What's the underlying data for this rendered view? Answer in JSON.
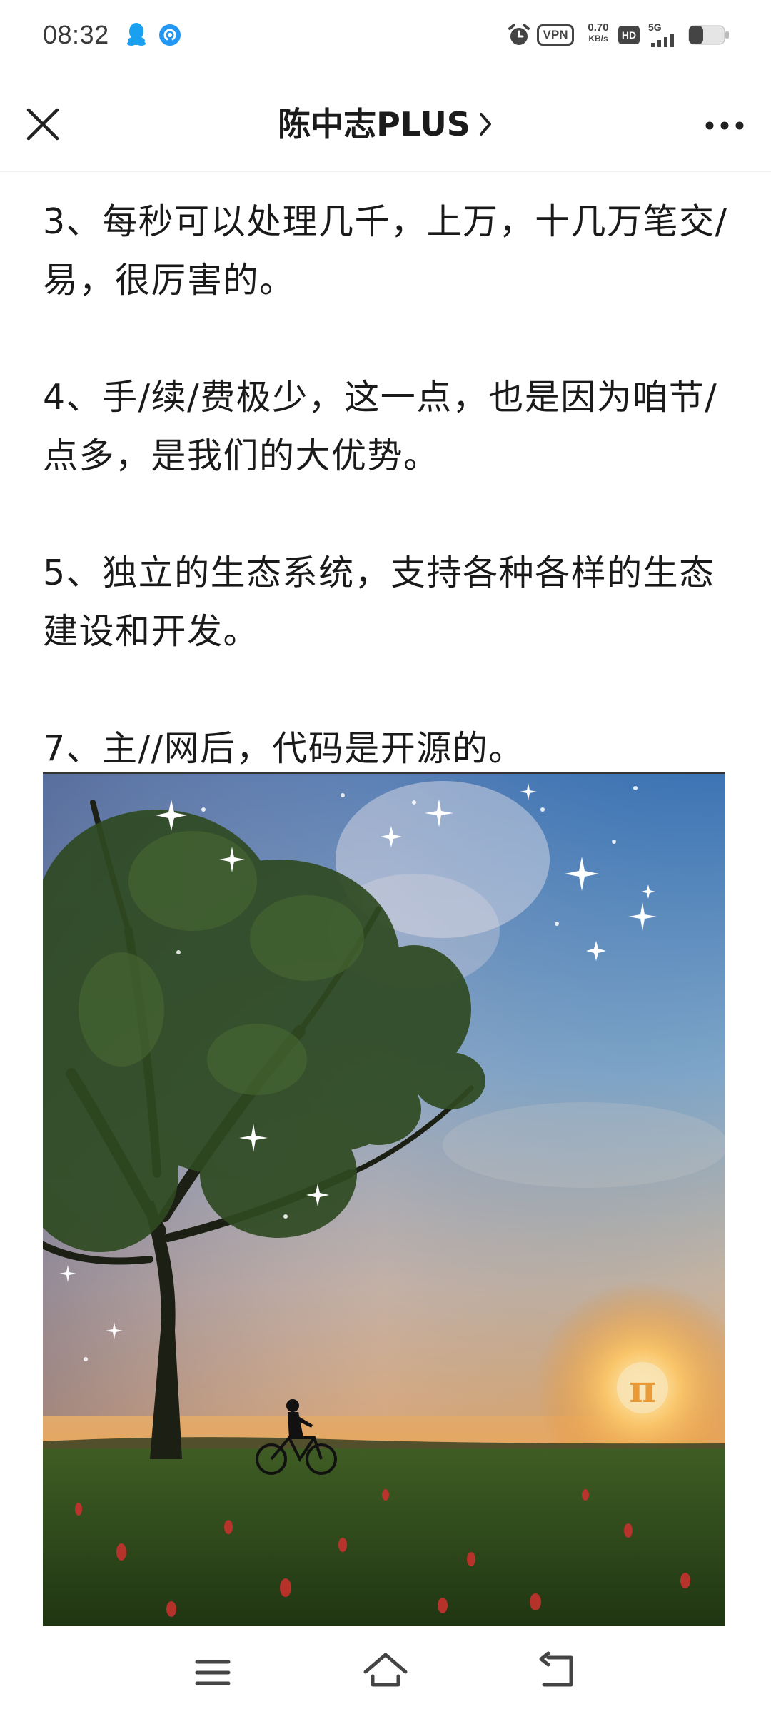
{
  "status_bar": {
    "time": "08:32",
    "left_icons": [
      "qq-icon",
      "browser-icon"
    ],
    "right_icons": [
      "alarm-icon",
      "vpn-badge",
      "network-speed",
      "hd-icon",
      "5g-signal-icon",
      "battery-icon"
    ],
    "vpn_label": "VPN",
    "speed_value": "0.70",
    "speed_unit": "KB/s",
    "hd_label": "HD",
    "network_type": "5G"
  },
  "header": {
    "title": "陈中志PLUS",
    "close_icon": "close-icon",
    "chevron_icon": "chevron-right-icon",
    "more_icon": "more-icon"
  },
  "article": {
    "paragraphs": [
      "3、每秒可以处理几千，上万，十几万笔交/易，很厉害的。",
      "4、手/续/费极少，这一点，也是因为咱节/点多，是我们的大优势。",
      "5、独立的生态系统，支持各种各样的生态建设和开发。",
      "7、主//网后，代码是开源的。"
    ],
    "image": {
      "description_icon": "landscape-photo",
      "logo_text": "π"
    }
  },
  "nav_bar": {
    "menu_icon": "menu-icon",
    "home_icon": "home-icon",
    "back_icon": "back-icon"
  },
  "colors": {
    "text": "#1a1a1a",
    "status_icons": "#444444",
    "qq_blue": "#1aa0f0",
    "browser_blue": "#2196f3"
  }
}
